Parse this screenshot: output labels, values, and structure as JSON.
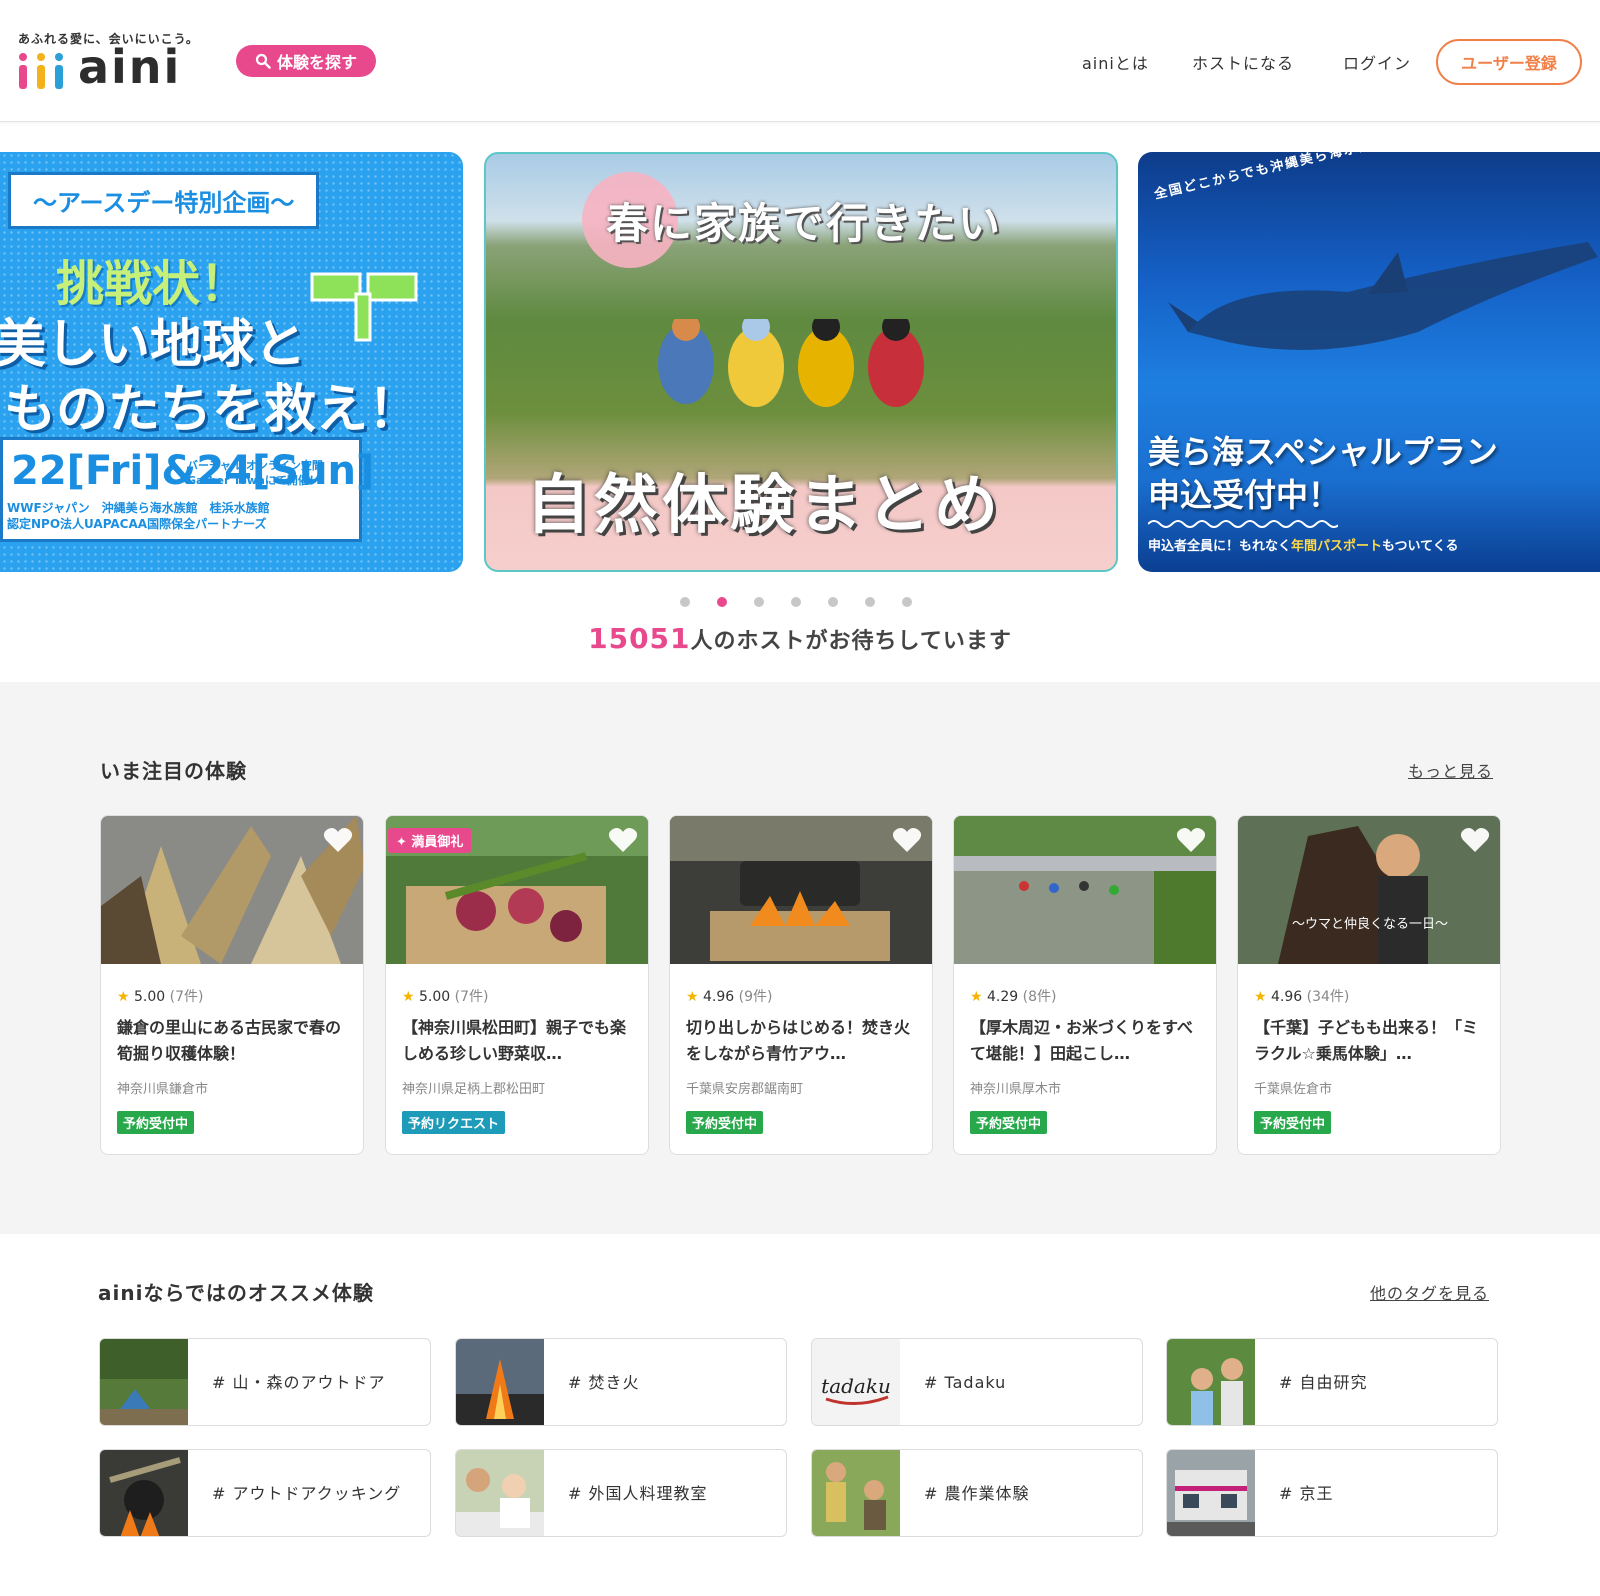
{
  "header": {
    "tagline": "あふれる愛に、会いにいこう。",
    "logo_text": "aini",
    "search_label": "体験を探す",
    "nav_about": "ainiとは",
    "nav_host": "ホストになる",
    "nav_login": "ログイン",
    "register": "ユーザー登録"
  },
  "carousel": {
    "slide1": {
      "badge": "〜アースデー特別企画〜",
      "title1": "挑戦状！",
      "title2": "美しい地球と",
      "title3": "ものたちを救え！",
      "date": "22[Fri]&24[Sun]",
      "venue_line1": "バーチャル/オンライン空間",
      "venue_line2": "Gather Townにて開催！",
      "orgs_line1": "WWFジャパン　沖縄美ら海水族館　桂浜水族館",
      "orgs_line2": "認定NPO法人UAPACAA国際保全パートナーズ"
    },
    "slide2": {
      "title": "春に家族で行きたい",
      "subtitle": "自然体験まとめ"
    },
    "slide3": {
      "arc": "全国どこからでも沖縄美ら海水族館が楽しめる",
      "title1": "美ら海スペシャルプラン",
      "title2": "申込受付中！",
      "note_a": "申込者全員に！もれなく",
      "note_hl": "年間パスポート",
      "note_b": "もついてくる"
    },
    "dot_count": 7,
    "active_dot": 2
  },
  "hosts": {
    "count": "15051",
    "suffix": "人のホストがお待ちしています"
  },
  "featured": {
    "title": "いま注目の体験",
    "more": "もっと見る",
    "cards": [
      {
        "rating": "5.00",
        "count": "(7件)",
        "title": "鎌倉の里山にある古民家で春の筍掘り収穫体験！",
        "location": "神奈川県鎌倉市",
        "status": "予約受付中",
        "badge": ""
      },
      {
        "rating": "5.00",
        "count": "(7件)",
        "title": "【神奈川県松田町】親子でも楽しめる珍しい野菜収…",
        "location": "神奈川県足柄上郡松田町",
        "status": "予約リクエスト",
        "badge": "満員御礼"
      },
      {
        "rating": "4.96",
        "count": "(9件)",
        "title": "切り出しからはじめる！焚き火をしながら青竹アウ…",
        "location": "千葉県安房郡鋸南町",
        "status": "予約受付中",
        "badge": ""
      },
      {
        "rating": "4.29",
        "count": "(8件)",
        "title": "【厚木周辺・お米づくりをすべて堪能！】田起こし…",
        "location": "神奈川県厚木市",
        "status": "予約受付中",
        "badge": ""
      },
      {
        "rating": "4.96",
        "count": "(34件)",
        "title": "【千葉】子どもも出来る！「ミラクル☆乗馬体験」…",
        "location": "千葉県佐倉市",
        "status": "予約受付中",
        "badge": "",
        "img_caption": "〜ウマと仲良くなる一日〜"
      }
    ]
  },
  "tags": {
    "title": "ainiならではのオススメ体験",
    "more": "他のタグを見る",
    "items": [
      {
        "label": "# 山・森のアウトドア"
      },
      {
        "label": "# 焚き火"
      },
      {
        "label": "# Tadaku",
        "img_text": "tadaku"
      },
      {
        "label": "# 自由研究"
      },
      {
        "label": "# アウトドアクッキング"
      },
      {
        "label": "# 外国人料理教室"
      },
      {
        "label": "# 農作業体験"
      },
      {
        "label": "# 京王"
      }
    ]
  },
  "colors": {
    "brand_pink": "#e8498c",
    "register_orange": "#f08048",
    "status_green": "#27a84a",
    "status_blue": "#1d9bb8"
  }
}
